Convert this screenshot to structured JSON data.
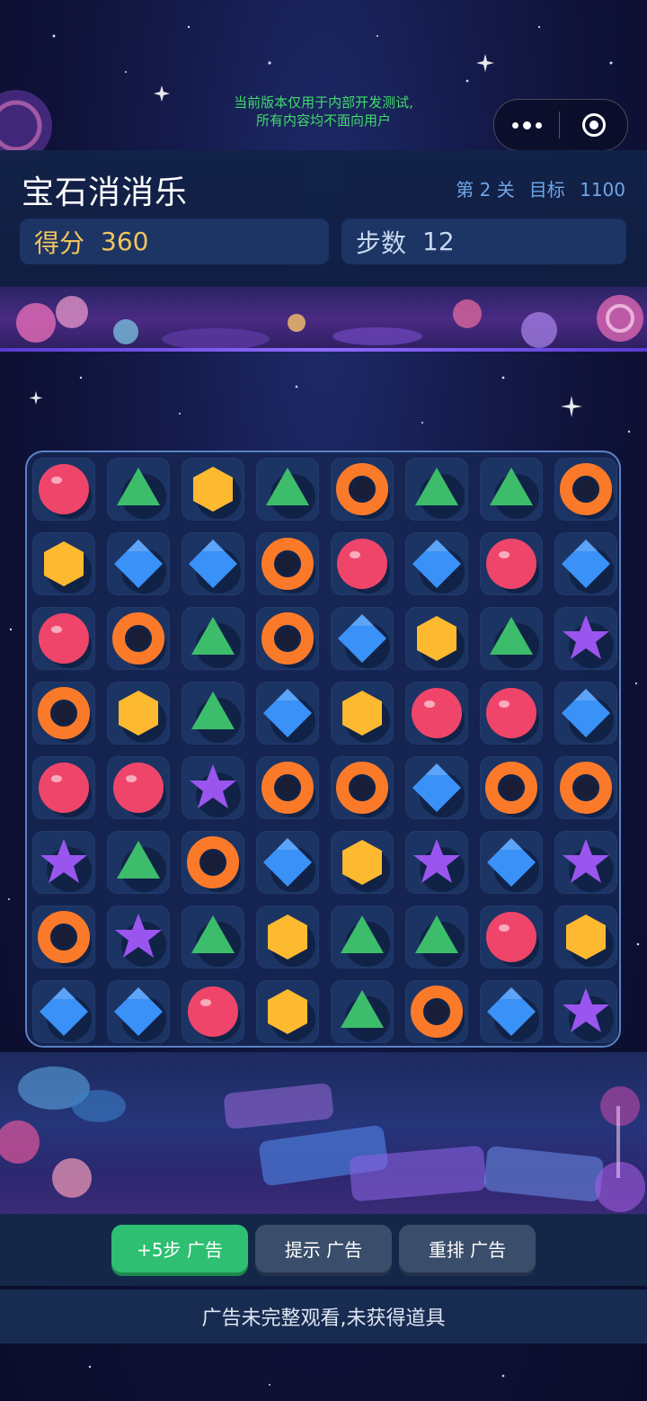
{
  "dev_notice": {
    "line1": "当前版本仅用于内部开发测试,",
    "line2": "所有内容均不面向用户"
  },
  "header": {
    "title": "宝石消消乐",
    "level_label": "第 2 关",
    "target_label": "目标",
    "target_value": "1100",
    "score_label": "得分",
    "score_value": "360",
    "steps_label": "步数",
    "steps_value": "12"
  },
  "board": {
    "rows": 8,
    "cols": 8,
    "gem_types": {
      "R": {
        "name": "red-orb",
        "color": "#f0456a"
      },
      "G": {
        "name": "green-triangle",
        "color": "#3dbd6b"
      },
      "Y": {
        "name": "yellow-hexagon",
        "color": "#fdb930"
      },
      "O": {
        "name": "orange-ring",
        "color": "#fb7a2a"
      },
      "B": {
        "name": "blue-diamond",
        "color": "#3a91f7"
      },
      "P": {
        "name": "purple-star",
        "color": "#9a55ef"
      }
    },
    "grid": [
      [
        "R",
        "G",
        "Y",
        "G",
        "O",
        "G",
        "G",
        "O"
      ],
      [
        "Y",
        "B",
        "B",
        "O",
        "R",
        "B",
        "R",
        "B"
      ],
      [
        "R",
        "O",
        "G",
        "O",
        "B",
        "Y",
        "G",
        "P"
      ],
      [
        "O",
        "Y",
        "G",
        "B",
        "Y",
        "R",
        "R",
        "B"
      ],
      [
        "R",
        "R",
        "P",
        "O",
        "O",
        "B",
        "O",
        "O"
      ],
      [
        "P",
        "G",
        "O",
        "B",
        "Y",
        "P",
        "B",
        "P"
      ],
      [
        "O",
        "P",
        "G",
        "Y",
        "G",
        "G",
        "R",
        "Y"
      ],
      [
        "B",
        "B",
        "R",
        "Y",
        "G",
        "O",
        "B",
        "P"
      ]
    ]
  },
  "actions": {
    "extra_steps": "+5步  广告",
    "hint": "提示  广告",
    "shuffle": "重排  广告"
  },
  "toast": "广告未完整观看,未获得道具"
}
